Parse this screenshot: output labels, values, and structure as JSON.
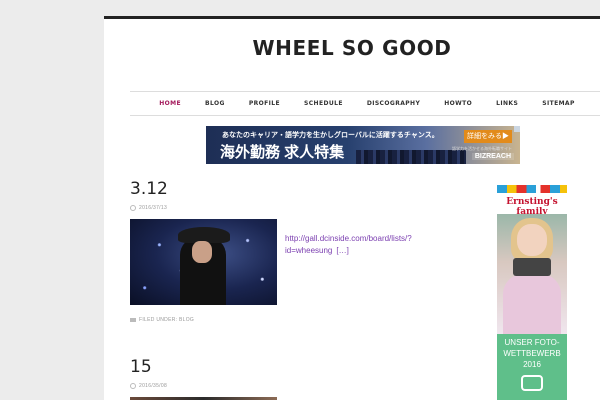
{
  "header": {
    "site_title": "WHEEL SO GOOD"
  },
  "nav": {
    "items": [
      {
        "label": "HOME",
        "active": true
      },
      {
        "label": "BLOG"
      },
      {
        "label": "PROFILE"
      },
      {
        "label": "SCHEDULE"
      },
      {
        "label": "DISCOGRAPHY"
      },
      {
        "label": "HOWTO"
      },
      {
        "label": "LINKS"
      },
      {
        "label": "SITEMAP"
      }
    ]
  },
  "banner_ad": {
    "top_text": "あなたのキャリア・語学力を生かしグローバルに活躍するチャンス。",
    "main_text": "海外勤務 求人特集",
    "button": "詳細をみる▶",
    "small_text": "語学力を活かせる海外転職サイト",
    "logo": "BIZREACH"
  },
  "posts": [
    {
      "title": "3.12",
      "date": "2016/37/13",
      "link": "http://gall.dcinside.com/board/lists/?id=wheesung",
      "more": "[…]",
      "filed": "FILED UNDER: BLOG"
    },
    {
      "title": "15",
      "date": "2016/35/08"
    }
  ],
  "side_ad": {
    "brand": "Ernsting's family",
    "text": "UNSER FOTO-WETTBEWERB 2016"
  },
  "colors": {
    "active_nav": "#a3195b",
    "link": "#7b3fb0"
  }
}
